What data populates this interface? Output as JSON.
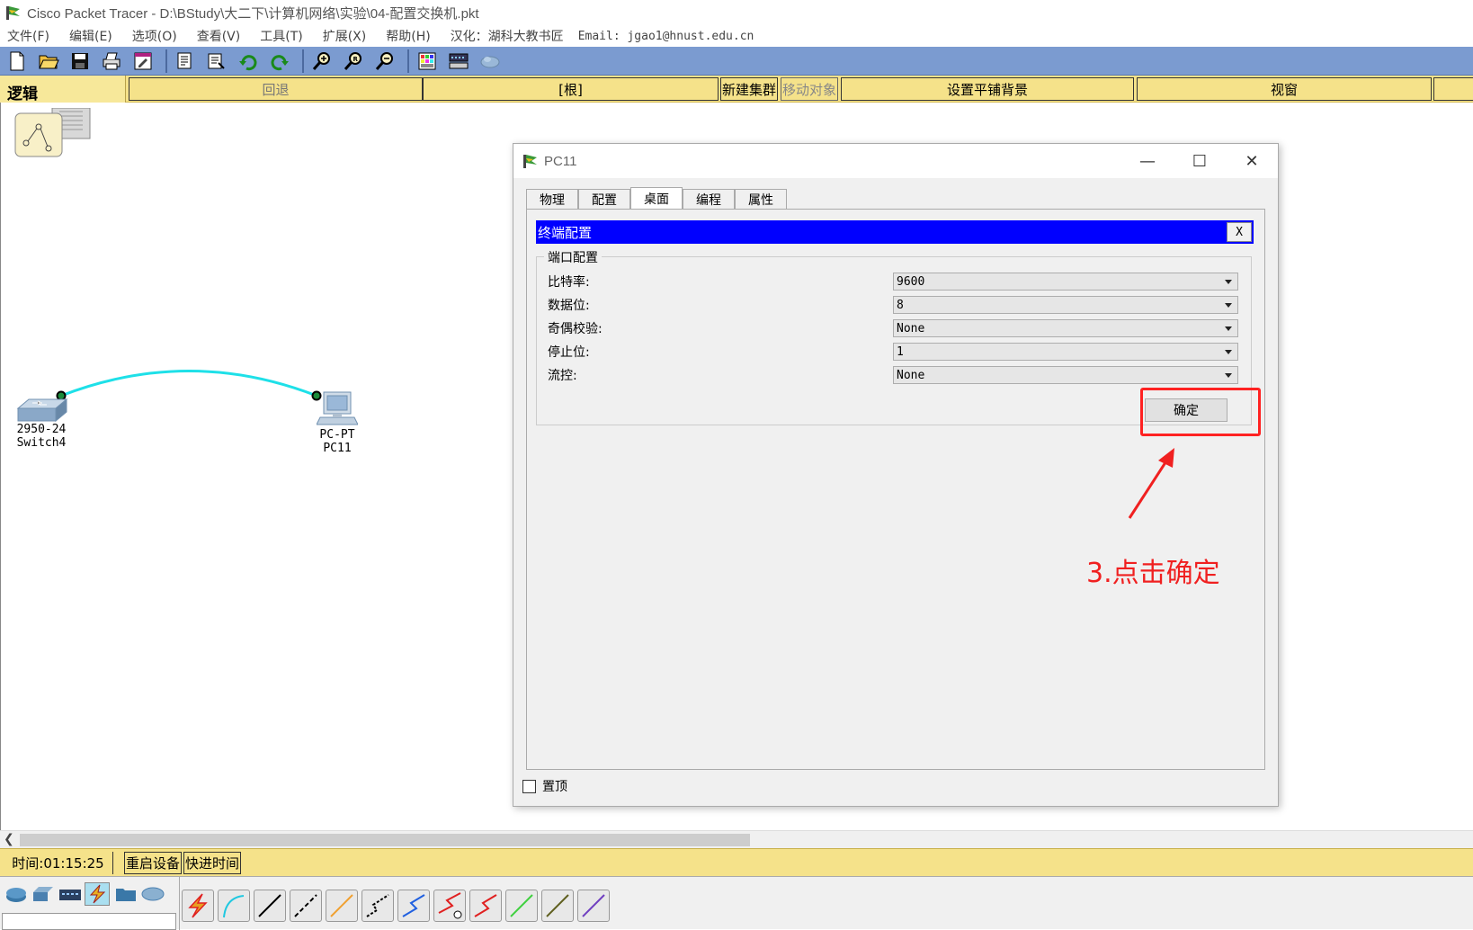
{
  "window": {
    "title": "Cisco Packet Tracer - D:\\BStudy\\大二下\\计算机网络\\实验\\04-配置交换机.pkt"
  },
  "menu": {
    "items": [
      "文件(F)",
      "编辑(E)",
      "选项(O)",
      "查看(V)",
      "工具(T)",
      "扩展(X)",
      "帮助(H)"
    ],
    "localization": "汉化：湖科大教书匠",
    "email": "Email: jgao1@hnust.edu.cn"
  },
  "toolbar": {
    "icons": [
      "new-file-icon",
      "open-folder-icon",
      "save-icon",
      "print-icon",
      "activity-wizard-icon",
      "copy-icon",
      "paste-icon",
      "undo-icon",
      "redo-icon",
      "zoom-in-icon",
      "zoom-reset-icon",
      "zoom-out-icon",
      "palette-icon",
      "device-template-icon",
      "cloud-icon"
    ]
  },
  "workbar": {
    "logic_tab": "逻辑",
    "back": "回退",
    "root": "[根]",
    "new_cluster": "新建集群",
    "move_object": "移动对象",
    "set_background": "设置平铺背景",
    "viewport": "视窗"
  },
  "canvas": {
    "switch": {
      "model": "2950-24",
      "name": "Switch4"
    },
    "pc": {
      "model": "PC-PT",
      "name": "PC11"
    },
    "link_color": "#1ee0e8"
  },
  "dialog": {
    "title": "PC11",
    "tabs": [
      "物理",
      "配置",
      "桌面",
      "编程",
      "属性"
    ],
    "active_tab": "桌面",
    "terminal": {
      "header": "终端配置",
      "close": "X",
      "group_label": "端口配置",
      "fields": [
        {
          "label": "比特率:",
          "value": "9600"
        },
        {
          "label": "数据位:",
          "value": "8"
        },
        {
          "label": "奇偶校验:",
          "value": "None"
        },
        {
          "label": "停止位:",
          "value": "1"
        },
        {
          "label": "流控:",
          "value": "None"
        }
      ],
      "ok_label": "确定"
    },
    "pin_label": "置顶",
    "pin_checked": false
  },
  "annotation": {
    "text": "3.点击确定",
    "color": "#f02020"
  },
  "status": {
    "time": "时间:01:15:25",
    "restart": "重启设备",
    "fast_forward": "快进时间"
  },
  "devices_bar": {
    "categories": [
      "routers-icon",
      "switches-icon",
      "hubs-icon",
      "connections-icon",
      "end-devices-icon",
      "wan-emulation-icon"
    ],
    "active_category": "connections-icon",
    "cables": [
      {
        "name": "auto-cable-icon",
        "color": "#e8a020"
      },
      {
        "name": "console-cable-icon",
        "color": "#20c8e0"
      },
      {
        "name": "straight-through-cable-icon",
        "color": "#000000"
      },
      {
        "name": "crossover-cable-icon",
        "color": "#000000"
      },
      {
        "name": "fiber-cable-icon",
        "color": "#f0a030"
      },
      {
        "name": "phone-cable-icon",
        "color": "#000000"
      },
      {
        "name": "coaxial-cable-icon",
        "color": "#2060e0"
      },
      {
        "name": "serial-dce-cable-icon",
        "color": "#e02020"
      },
      {
        "name": "serial-dte-cable-icon",
        "color": "#e02020"
      },
      {
        "name": "octal-cable-icon",
        "color": "#40d040"
      },
      {
        "name": "iot-custom-cable-icon",
        "color": "#606020"
      },
      {
        "name": "usb-cable-icon",
        "color": "#7040c0"
      }
    ]
  }
}
